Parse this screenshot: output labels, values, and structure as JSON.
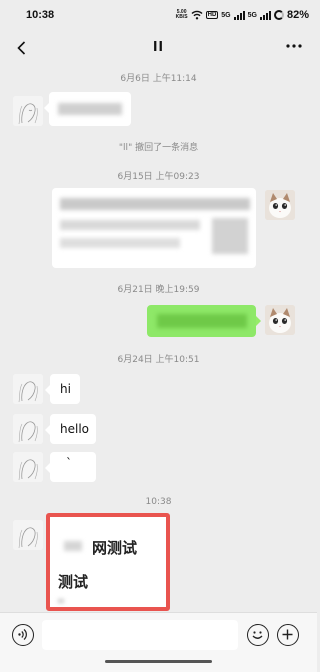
{
  "status_bar": {
    "time": "10:38",
    "net_speed_value": "5.00",
    "net_speed_unit": "KB/S",
    "hd_label": "HD",
    "sim1_label": "5G",
    "sim2_label": "5G",
    "battery_percent": "82%"
  },
  "nav": {
    "back_icon": "chevron-left-icon",
    "title": "ll",
    "more_icon": "more-dots-icon",
    "back_glyph": "‹",
    "more_glyph": "···"
  },
  "messages": {
    "ts1": "6月6日 上午11:14",
    "recall_note": "\"ll\" 撤回了一条消息",
    "ts2": "6月15日 上午09:23",
    "ts3": "6月21日 晚上19:59",
    "ts4": "6月24日 上午10:51",
    "msg_hi": "hi",
    "msg_hello": "hello",
    "msg_dot": "`",
    "ts5": "10:38",
    "last_line1": "网测试",
    "last_line2": "测试"
  },
  "input_bar": {
    "voice_icon": "voice-icon",
    "emoji_icon": "emoji-icon",
    "plus_icon": "plus-icon",
    "input_value": ""
  },
  "colors": {
    "sent_bubble": "#95ec69",
    "highlight": "#e9544f",
    "background": "#ededed"
  }
}
